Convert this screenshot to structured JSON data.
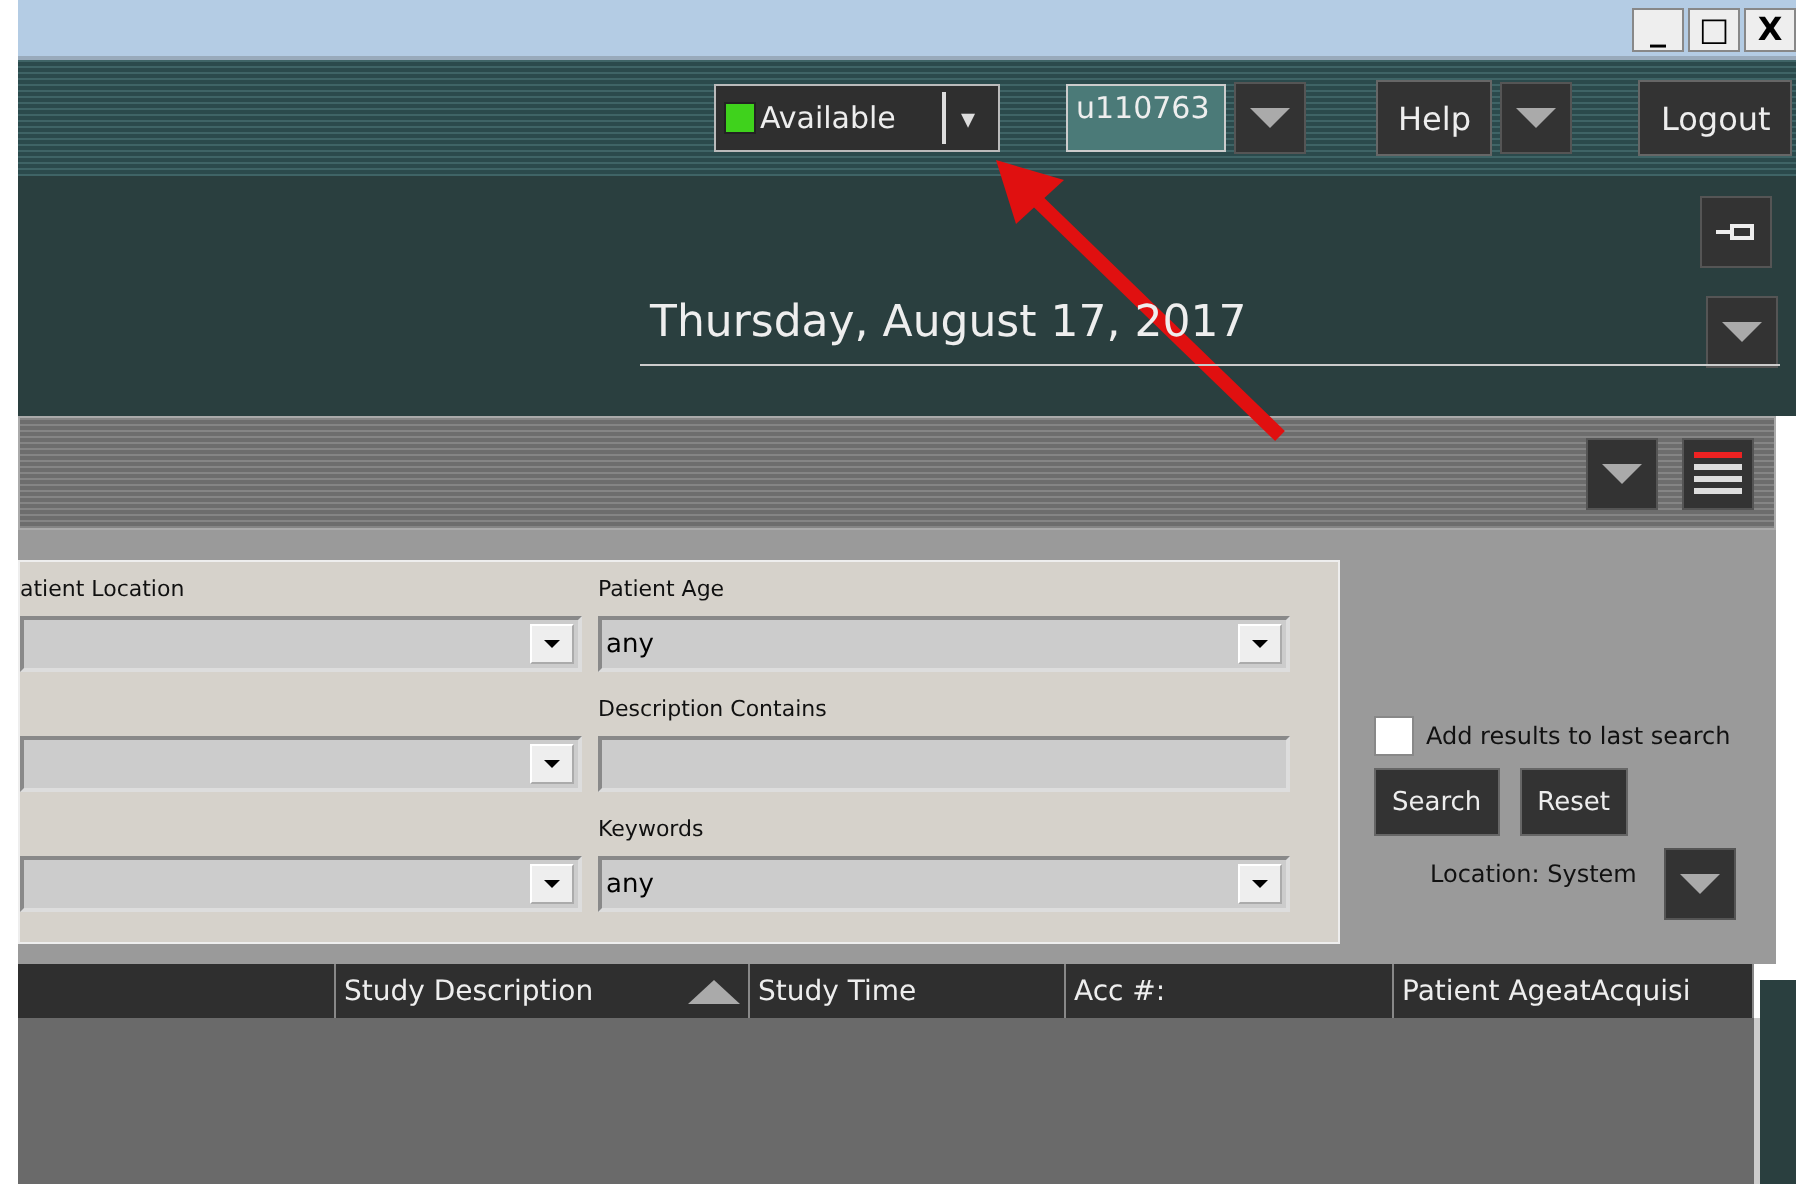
{
  "window_controls": [
    "_",
    "□",
    "X"
  ],
  "toolbar": {
    "status": {
      "label": "Available",
      "color": "#3fd21c",
      "arrow": "▾"
    },
    "user": "u110763",
    "help": "Help",
    "logout": "Logout"
  },
  "date": "Thursday, August 17, 2017",
  "filters": {
    "left": [
      {
        "label": "atient Location",
        "kind": "dropdown"
      },
      {
        "kind": "dropdown"
      },
      {
        "kind": "dropdown"
      }
    ],
    "right": [
      {
        "label": "Patient Age",
        "value": "any",
        "kind": "dropdown"
      },
      {
        "label": "Description Contains",
        "kind": "text"
      },
      {
        "label": "Keywords",
        "value": "any",
        "kind": "dropdown"
      }
    ]
  },
  "add_results": {
    "label": "Add results to last search",
    "checked": false
  },
  "buttons": [
    "Search",
    "Reset"
  ],
  "location": "Location: System",
  "table": {
    "columns": [
      {
        "sorted": false
      },
      {
        "label": "Study Description",
        "sorted": true
      },
      {
        "label": "Study Time",
        "sorted": false
      },
      {
        "label": "Acc #:",
        "sorted": false
      },
      {
        "label": "Patient AgeatAcquisi",
        "sorted": false
      }
    ]
  }
}
